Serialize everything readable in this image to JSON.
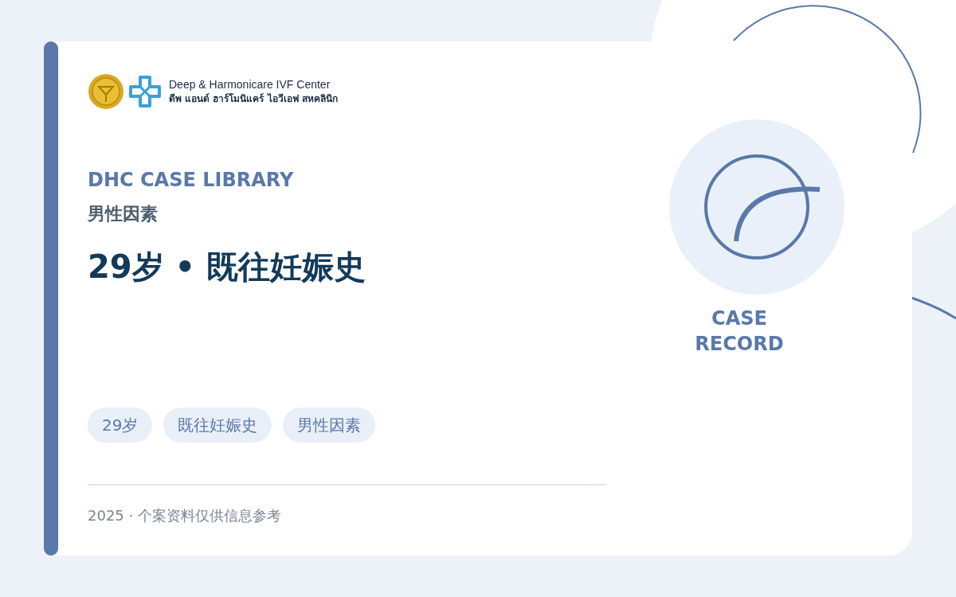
{
  "brand": {
    "name_en": "Deep & Harmonicare IVF Center",
    "name_th": "ดีพ แอนด์ ฮาร์โมนิแคร์ ไอวีเอฟ สหคลินิก"
  },
  "eyebrow": "DHC CASE LIBRARY",
  "category": "男性因素",
  "title": "29岁 • 既往妊娠史",
  "tags": [
    "29岁",
    "既往妊娠史",
    "男性因素"
  ],
  "footer": "2025 · 个案资料仅供信息参考",
  "side_label": "CASE RECORD"
}
